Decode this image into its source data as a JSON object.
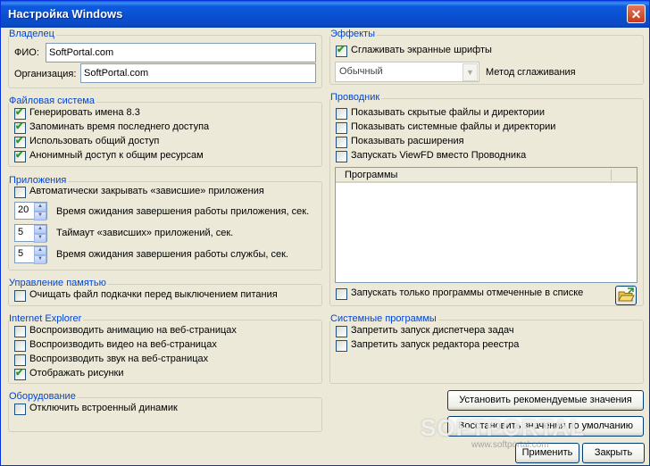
{
  "window": {
    "title": "Настройка Windows",
    "close_glyph": "✕"
  },
  "owner": {
    "legend": "Владелец",
    "fio_label": "ФИО:",
    "fio_value": "SoftPortal.com",
    "org_label": "Организация:",
    "org_value": "SoftPortal.com"
  },
  "fs": {
    "legend": "Файловая система",
    "items": [
      {
        "label": "Генерировать имена 8.3",
        "checked": true
      },
      {
        "label": "Запоминать время последнего доступа",
        "checked": true
      },
      {
        "label": "Использовать общий доступ",
        "checked": true
      },
      {
        "label": "Анонимный доступ к общим ресурсам",
        "checked": true
      }
    ]
  },
  "apps": {
    "legend": "Приложения",
    "autoclose": {
      "label": "Автоматически закрывать «зависшие» приложения",
      "checked": false
    },
    "spins": [
      {
        "value": "20",
        "label": "Время ожидания завершения работы приложения, сек."
      },
      {
        "value": "5",
        "label": "Таймаут «зависших» приложений, сек."
      },
      {
        "value": "5",
        "label": "Время ожидания завершения работы службы, сек."
      }
    ]
  },
  "memory": {
    "legend": "Управление памятью",
    "item": {
      "label": "Очищать файл подкачки перед выключением питания",
      "checked": false
    }
  },
  "ie": {
    "legend": "Internet Explorer",
    "items": [
      {
        "label": "Воспроизводить анимацию на веб-страницах",
        "checked": false
      },
      {
        "label": "Воспроизводить видео на веб-страницах",
        "checked": false
      },
      {
        "label": "Воспроизводить звук на веб-страницах",
        "checked": false
      },
      {
        "label": "Отображать рисунки",
        "checked": true
      }
    ]
  },
  "hardware": {
    "legend": "Оборудование",
    "item": {
      "label": "Отключить встроенный динамик",
      "checked": false
    }
  },
  "effects": {
    "legend": "Эффекты",
    "smooth": {
      "label": "Сглаживать экранные шрифты",
      "checked": true
    },
    "combo_value": "Обычный",
    "combo_label": "Метод сглаживания"
  },
  "explorer": {
    "legend": "Проводник",
    "items": [
      {
        "label": "Показывать скрытые файлы и директории",
        "checked": false
      },
      {
        "label": "Показывать системные файлы и директории",
        "checked": false
      },
      {
        "label": "Показывать расширения",
        "checked": false
      },
      {
        "label": "Запускать ViewFD вместо Проводника",
        "checked": false
      }
    ],
    "list_header": "Программы",
    "only_marked": {
      "label": "Запускать только программы отмеченные в списке",
      "checked": false
    }
  },
  "sysprog": {
    "legend": "Системные программы",
    "items": [
      {
        "label": "Запретить запуск диспетчера задач",
        "checked": false
      },
      {
        "label": "Запретить запуск редактора реестра",
        "checked": false
      }
    ]
  },
  "buttons": {
    "recommended": "Установить рекомендуемые значения",
    "defaults": "Восстановить значения по умолчанию",
    "apply": "Применить",
    "close": "Закрыть"
  },
  "watermark": {
    "text": "SOFTPORTAL",
    "url": "www.softportal.com"
  },
  "colors": {
    "accent": "#0046d5",
    "check": "#21a121",
    "titlebar": "#0a4fcf"
  }
}
